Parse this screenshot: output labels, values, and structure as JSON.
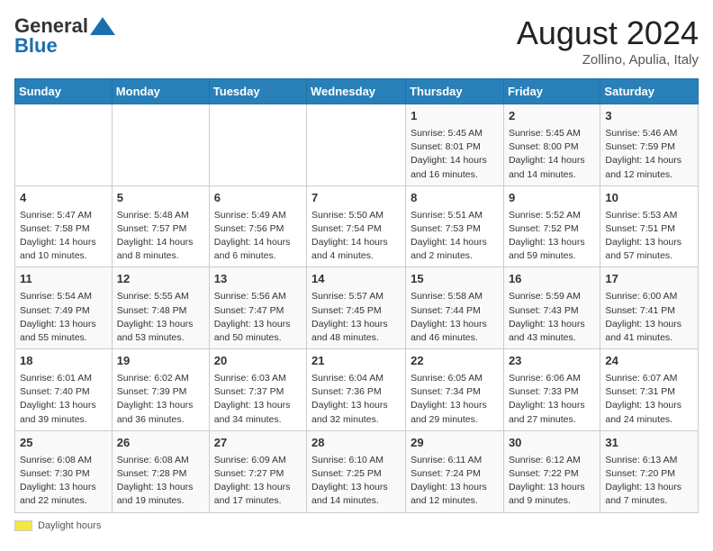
{
  "header": {
    "logo_general": "General",
    "logo_blue": "Blue",
    "month_year": "August 2024",
    "location": "Zollino, Apulia, Italy"
  },
  "days_of_week": [
    "Sunday",
    "Monday",
    "Tuesday",
    "Wednesday",
    "Thursday",
    "Friday",
    "Saturday"
  ],
  "footer": {
    "label": "Daylight hours"
  },
  "weeks": [
    [
      {
        "day": "",
        "info": ""
      },
      {
        "day": "",
        "info": ""
      },
      {
        "day": "",
        "info": ""
      },
      {
        "day": "",
        "info": ""
      },
      {
        "day": "1",
        "info": "Sunrise: 5:45 AM\nSunset: 8:01 PM\nDaylight: 14 hours and 16 minutes."
      },
      {
        "day": "2",
        "info": "Sunrise: 5:45 AM\nSunset: 8:00 PM\nDaylight: 14 hours and 14 minutes."
      },
      {
        "day": "3",
        "info": "Sunrise: 5:46 AM\nSunset: 7:59 PM\nDaylight: 14 hours and 12 minutes."
      }
    ],
    [
      {
        "day": "4",
        "info": "Sunrise: 5:47 AM\nSunset: 7:58 PM\nDaylight: 14 hours and 10 minutes."
      },
      {
        "day": "5",
        "info": "Sunrise: 5:48 AM\nSunset: 7:57 PM\nDaylight: 14 hours and 8 minutes."
      },
      {
        "day": "6",
        "info": "Sunrise: 5:49 AM\nSunset: 7:56 PM\nDaylight: 14 hours and 6 minutes."
      },
      {
        "day": "7",
        "info": "Sunrise: 5:50 AM\nSunset: 7:54 PM\nDaylight: 14 hours and 4 minutes."
      },
      {
        "day": "8",
        "info": "Sunrise: 5:51 AM\nSunset: 7:53 PM\nDaylight: 14 hours and 2 minutes."
      },
      {
        "day": "9",
        "info": "Sunrise: 5:52 AM\nSunset: 7:52 PM\nDaylight: 13 hours and 59 minutes."
      },
      {
        "day": "10",
        "info": "Sunrise: 5:53 AM\nSunset: 7:51 PM\nDaylight: 13 hours and 57 minutes."
      }
    ],
    [
      {
        "day": "11",
        "info": "Sunrise: 5:54 AM\nSunset: 7:49 PM\nDaylight: 13 hours and 55 minutes."
      },
      {
        "day": "12",
        "info": "Sunrise: 5:55 AM\nSunset: 7:48 PM\nDaylight: 13 hours and 53 minutes."
      },
      {
        "day": "13",
        "info": "Sunrise: 5:56 AM\nSunset: 7:47 PM\nDaylight: 13 hours and 50 minutes."
      },
      {
        "day": "14",
        "info": "Sunrise: 5:57 AM\nSunset: 7:45 PM\nDaylight: 13 hours and 48 minutes."
      },
      {
        "day": "15",
        "info": "Sunrise: 5:58 AM\nSunset: 7:44 PM\nDaylight: 13 hours and 46 minutes."
      },
      {
        "day": "16",
        "info": "Sunrise: 5:59 AM\nSunset: 7:43 PM\nDaylight: 13 hours and 43 minutes."
      },
      {
        "day": "17",
        "info": "Sunrise: 6:00 AM\nSunset: 7:41 PM\nDaylight: 13 hours and 41 minutes."
      }
    ],
    [
      {
        "day": "18",
        "info": "Sunrise: 6:01 AM\nSunset: 7:40 PM\nDaylight: 13 hours and 39 minutes."
      },
      {
        "day": "19",
        "info": "Sunrise: 6:02 AM\nSunset: 7:39 PM\nDaylight: 13 hours and 36 minutes."
      },
      {
        "day": "20",
        "info": "Sunrise: 6:03 AM\nSunset: 7:37 PM\nDaylight: 13 hours and 34 minutes."
      },
      {
        "day": "21",
        "info": "Sunrise: 6:04 AM\nSunset: 7:36 PM\nDaylight: 13 hours and 32 minutes."
      },
      {
        "day": "22",
        "info": "Sunrise: 6:05 AM\nSunset: 7:34 PM\nDaylight: 13 hours and 29 minutes."
      },
      {
        "day": "23",
        "info": "Sunrise: 6:06 AM\nSunset: 7:33 PM\nDaylight: 13 hours and 27 minutes."
      },
      {
        "day": "24",
        "info": "Sunrise: 6:07 AM\nSunset: 7:31 PM\nDaylight: 13 hours and 24 minutes."
      }
    ],
    [
      {
        "day": "25",
        "info": "Sunrise: 6:08 AM\nSunset: 7:30 PM\nDaylight: 13 hours and 22 minutes."
      },
      {
        "day": "26",
        "info": "Sunrise: 6:08 AM\nSunset: 7:28 PM\nDaylight: 13 hours and 19 minutes."
      },
      {
        "day": "27",
        "info": "Sunrise: 6:09 AM\nSunset: 7:27 PM\nDaylight: 13 hours and 17 minutes."
      },
      {
        "day": "28",
        "info": "Sunrise: 6:10 AM\nSunset: 7:25 PM\nDaylight: 13 hours and 14 minutes."
      },
      {
        "day": "29",
        "info": "Sunrise: 6:11 AM\nSunset: 7:24 PM\nDaylight: 13 hours and 12 minutes."
      },
      {
        "day": "30",
        "info": "Sunrise: 6:12 AM\nSunset: 7:22 PM\nDaylight: 13 hours and 9 minutes."
      },
      {
        "day": "31",
        "info": "Sunrise: 6:13 AM\nSunset: 7:20 PM\nDaylight: 13 hours and 7 minutes."
      }
    ]
  ]
}
